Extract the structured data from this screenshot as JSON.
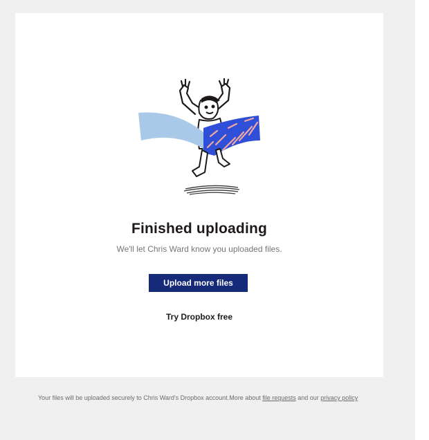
{
  "card": {
    "title": "Finished uploading",
    "subtitle": "We'll let Chris Ward know you uploaded files.",
    "upload_button": "Upload more files",
    "try_link": "Try Dropbox free",
    "illustration": "celebrating-person-illustration"
  },
  "footer": {
    "text_1": "Your files will be uploaded securely to Chris Ward's Dropbox account.More about ",
    "link_file_requests": "file requests",
    "text_2": " and our ",
    "link_privacy": "privacy policy"
  },
  "colors": {
    "button_bg": "#162a7a",
    "page_bg": "#f0f0f0",
    "card_bg": "#ffffff",
    "accent_blue": "#2f4fd8",
    "accent_pink": "#f2a7a0",
    "accent_light_blue": "#a9c9e8"
  }
}
